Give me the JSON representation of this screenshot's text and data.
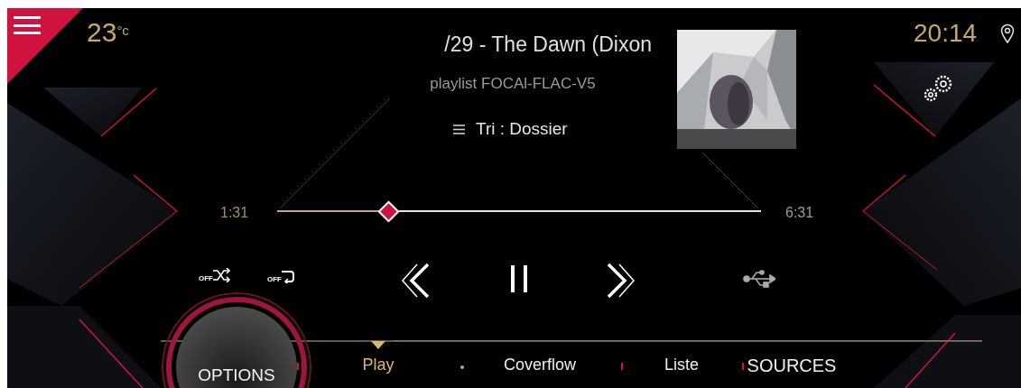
{
  "status_bar": {
    "temperature": "23",
    "temperature_unit": "°c",
    "clock": "20:14"
  },
  "track": {
    "title": "/29 - The Dawn (Dixon",
    "playlist": "playlist FOCAl-FLAC-V5",
    "sort": "Tri : Dossier"
  },
  "progress": {
    "elapsed": "1:31",
    "total": "6:31",
    "level": 0.23
  },
  "controls": {
    "shuffle_label": "OFF",
    "repeat_label": "OFF"
  },
  "nav_tabs": [
    {
      "label": "OPTIONS",
      "kind": "round",
      "selected": false
    },
    {
      "label": "Play",
      "kind": "tab",
      "selected": true
    },
    {
      "label": "Coverflow",
      "kind": "tab",
      "selected": false
    },
    {
      "label": "Liste",
      "kind": "tab",
      "selected": false
    },
    {
      "label": "SOURCES",
      "kind": "tab",
      "selected": false
    }
  ]
}
